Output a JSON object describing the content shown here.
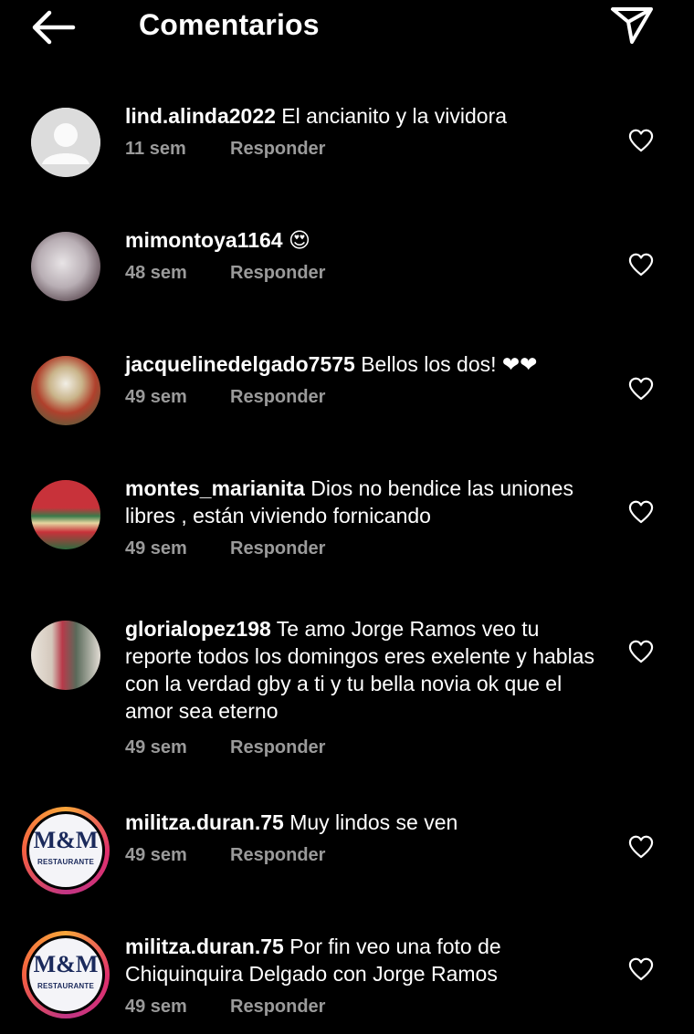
{
  "header": {
    "title": "Comentarios"
  },
  "comments": [
    {
      "username": "lind.alinda2022",
      "text": "El ancianito y la vividora",
      "time": "11 sem",
      "reply": "Responder"
    },
    {
      "username": "mimontoya1164",
      "text": "😍",
      "time": "48 sem",
      "reply": "Responder"
    },
    {
      "username": "jacquelinedelgado7575",
      "text": "Bellos los dos! ❤❤",
      "time": "49 sem",
      "reply": "Responder"
    },
    {
      "username": "montes_marianita",
      "text": "Dios no bendice las uniones libres , están viviendo fornicando",
      "time": "49 sem",
      "reply": "Responder"
    },
    {
      "username": "glorialopez198",
      "text": "Te amo Jorge Ramos veo tu reporte todos los domingos eres exelente y hablas con la verdad gby a ti y tu bella novia ok que el amor sea eterno",
      "time": "49 sem",
      "reply": "Responder"
    },
    {
      "username": "militza.duran.75",
      "text": "Muy lindos se ven",
      "time": "49 sem",
      "reply": "Responder"
    },
    {
      "username": "militza.duran.75",
      "text": "Por fin veo una foto de Chiquinquira Delgado con Jorge Ramos",
      "time": "49 sem",
      "reply": "Responder"
    }
  ],
  "logo_text": {
    "letters": "M&M",
    "banner": "RESTAURANTE"
  },
  "colors": {
    "background": "#000000",
    "secondary_text": "#9a9a9a",
    "ring_gradient": [
      "#f9a63a",
      "#e1306c",
      "#c13584"
    ]
  },
  "icons": {
    "back": "arrow-left-icon",
    "send": "paper-plane-icon",
    "like": "heart-outline-icon"
  }
}
